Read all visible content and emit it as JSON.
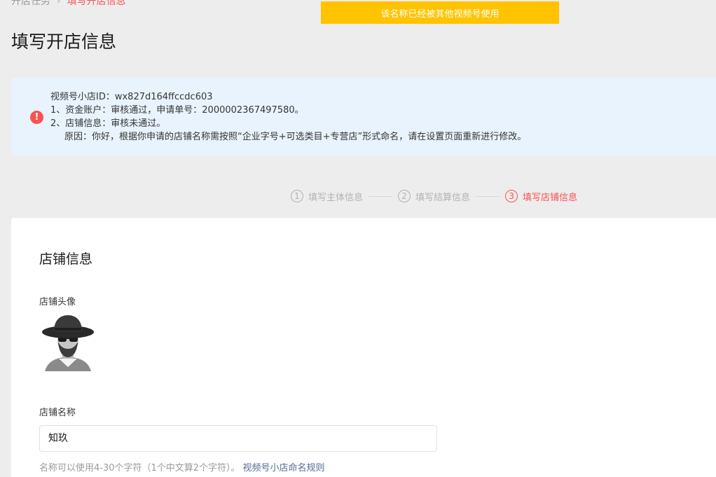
{
  "breadcrumb": {
    "parent": "开店任务",
    "separator": "›",
    "current": "填写开店信息"
  },
  "toast": {
    "message": "该名称已经被其他视频号使用"
  },
  "page": {
    "title": "填写开店信息"
  },
  "notice": {
    "line1": "视频号小店ID：wx827d164ffccdc603",
    "line2": "1、资金账户：审核通过，申请单号：2000002367497580。",
    "line3": "2、店铺信息：审核未通过。",
    "line4": "原因：你好，根据你申请的店铺名称需按照“企业字号+可选类目+专营店”形式命名，请在设置页面重新进行修改。",
    "icon_symbol": "!"
  },
  "steps": [
    {
      "num": "1",
      "label": "填写主体信息",
      "state": "done"
    },
    {
      "num": "2",
      "label": "填写结算信息",
      "state": "done"
    },
    {
      "num": "3",
      "label": "填写店铺信息",
      "state": "active"
    }
  ],
  "form": {
    "section_title": "店铺信息",
    "avatar_label": "店铺头像",
    "name_label": "店铺名称",
    "name_value": "知玖",
    "hint_text": "名称可以使用4-30个字符（1个中文算2个字符）。",
    "hint_link": "视频号小店命名规则"
  },
  "colors": {
    "accent": "#fa5151",
    "toast": "#ffc300",
    "link": "#576b95",
    "notice_bg": "#e8f3fd"
  }
}
